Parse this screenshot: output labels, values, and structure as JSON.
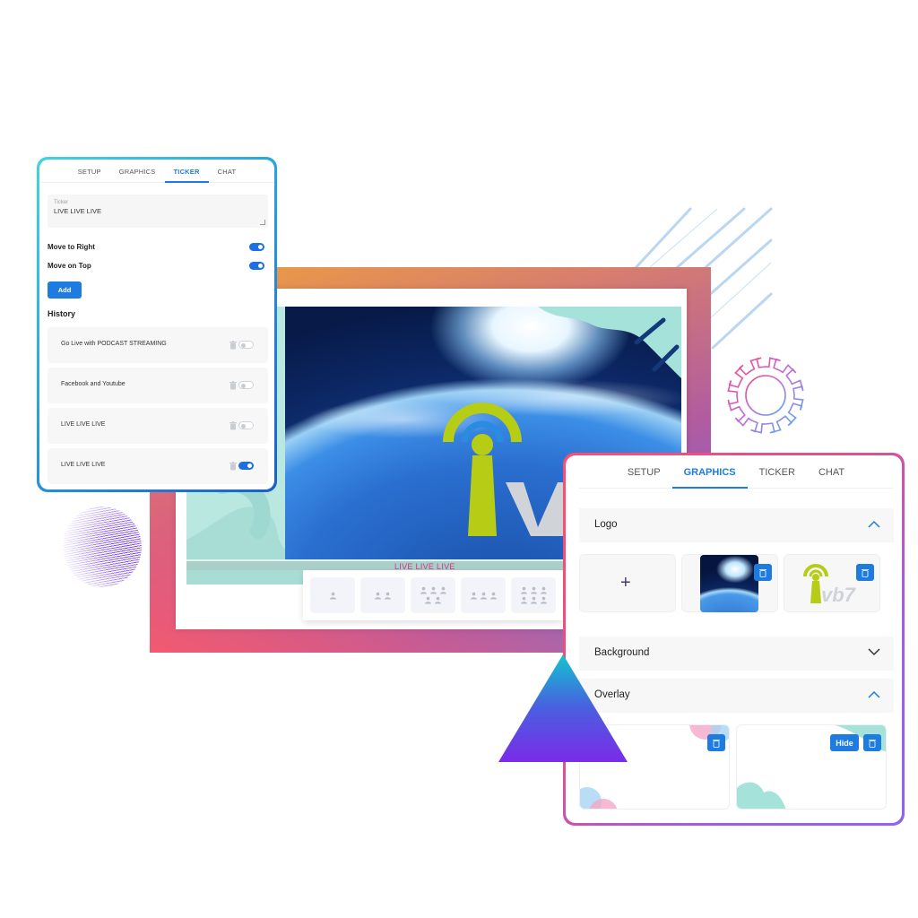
{
  "ticker_panel": {
    "tabs": [
      {
        "label": "SETUP",
        "active": false
      },
      {
        "label": "GRAPHICS",
        "active": false
      },
      {
        "label": "TICKER",
        "active": true
      },
      {
        "label": "CHAT",
        "active": false
      }
    ],
    "ticker_field": {
      "label": "Ticker",
      "value": "LIVE LIVE LIVE"
    },
    "options": [
      {
        "label": "Move to Right",
        "enabled": true
      },
      {
        "label": "Move on Top",
        "enabled": true
      }
    ],
    "add_label": "Add",
    "history_title": "History",
    "history": [
      {
        "text": "Go Live with PODCAST STREAMING",
        "enabled": false
      },
      {
        "text": "Facebook and Youtube",
        "enabled": false
      },
      {
        "text": "LIVE LIVE LIVE",
        "enabled": false
      },
      {
        "text": "LIVE LIVE LIVE",
        "enabled": true
      }
    ]
  },
  "stage": {
    "ticker_text": "LIVE LIVE LIVE",
    "layouts": [
      {
        "name": "single",
        "people": 1
      },
      {
        "name": "two",
        "people": 2
      },
      {
        "name": "five",
        "people": 5
      },
      {
        "name": "three",
        "people": 3
      },
      {
        "name": "six",
        "people": 6
      }
    ]
  },
  "graphics_panel": {
    "tabs": [
      {
        "label": "SETUP",
        "active": false
      },
      {
        "label": "GRAPHICS",
        "active": true
      },
      {
        "label": "TICKER",
        "active": false
      },
      {
        "label": "CHAT",
        "active": false
      }
    ],
    "sections": [
      {
        "label": "Logo",
        "expanded": true
      },
      {
        "label": "Background",
        "expanded": false
      },
      {
        "label": "Overlay",
        "expanded": true
      }
    ],
    "logo_add_symbol": "+",
    "overlay_hide_label": "Hide"
  },
  "colors": {
    "accent": "#1e7be0",
    "ticker_text": "#d8328c"
  }
}
